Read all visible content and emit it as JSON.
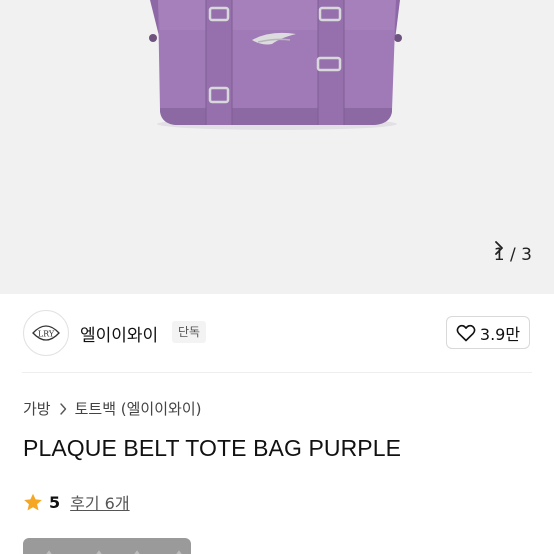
{
  "gallery": {
    "current_page": "1",
    "separator": "/",
    "total_pages": "3",
    "product_color": "#9e78b4"
  },
  "brand": {
    "logo_text": "LRY",
    "name": "엘이이와이",
    "exclusive_badge": "단독",
    "likes": "3.9만"
  },
  "breadcrumb": {
    "category": "가방",
    "subcategory": "토트백 (엘이이와이)"
  },
  "product": {
    "title": "PLAQUE BELT TOTE BAG PURPLE"
  },
  "rating": {
    "score": "5",
    "reviews_label": "후기 6개",
    "star_color": "#f5a623"
  }
}
